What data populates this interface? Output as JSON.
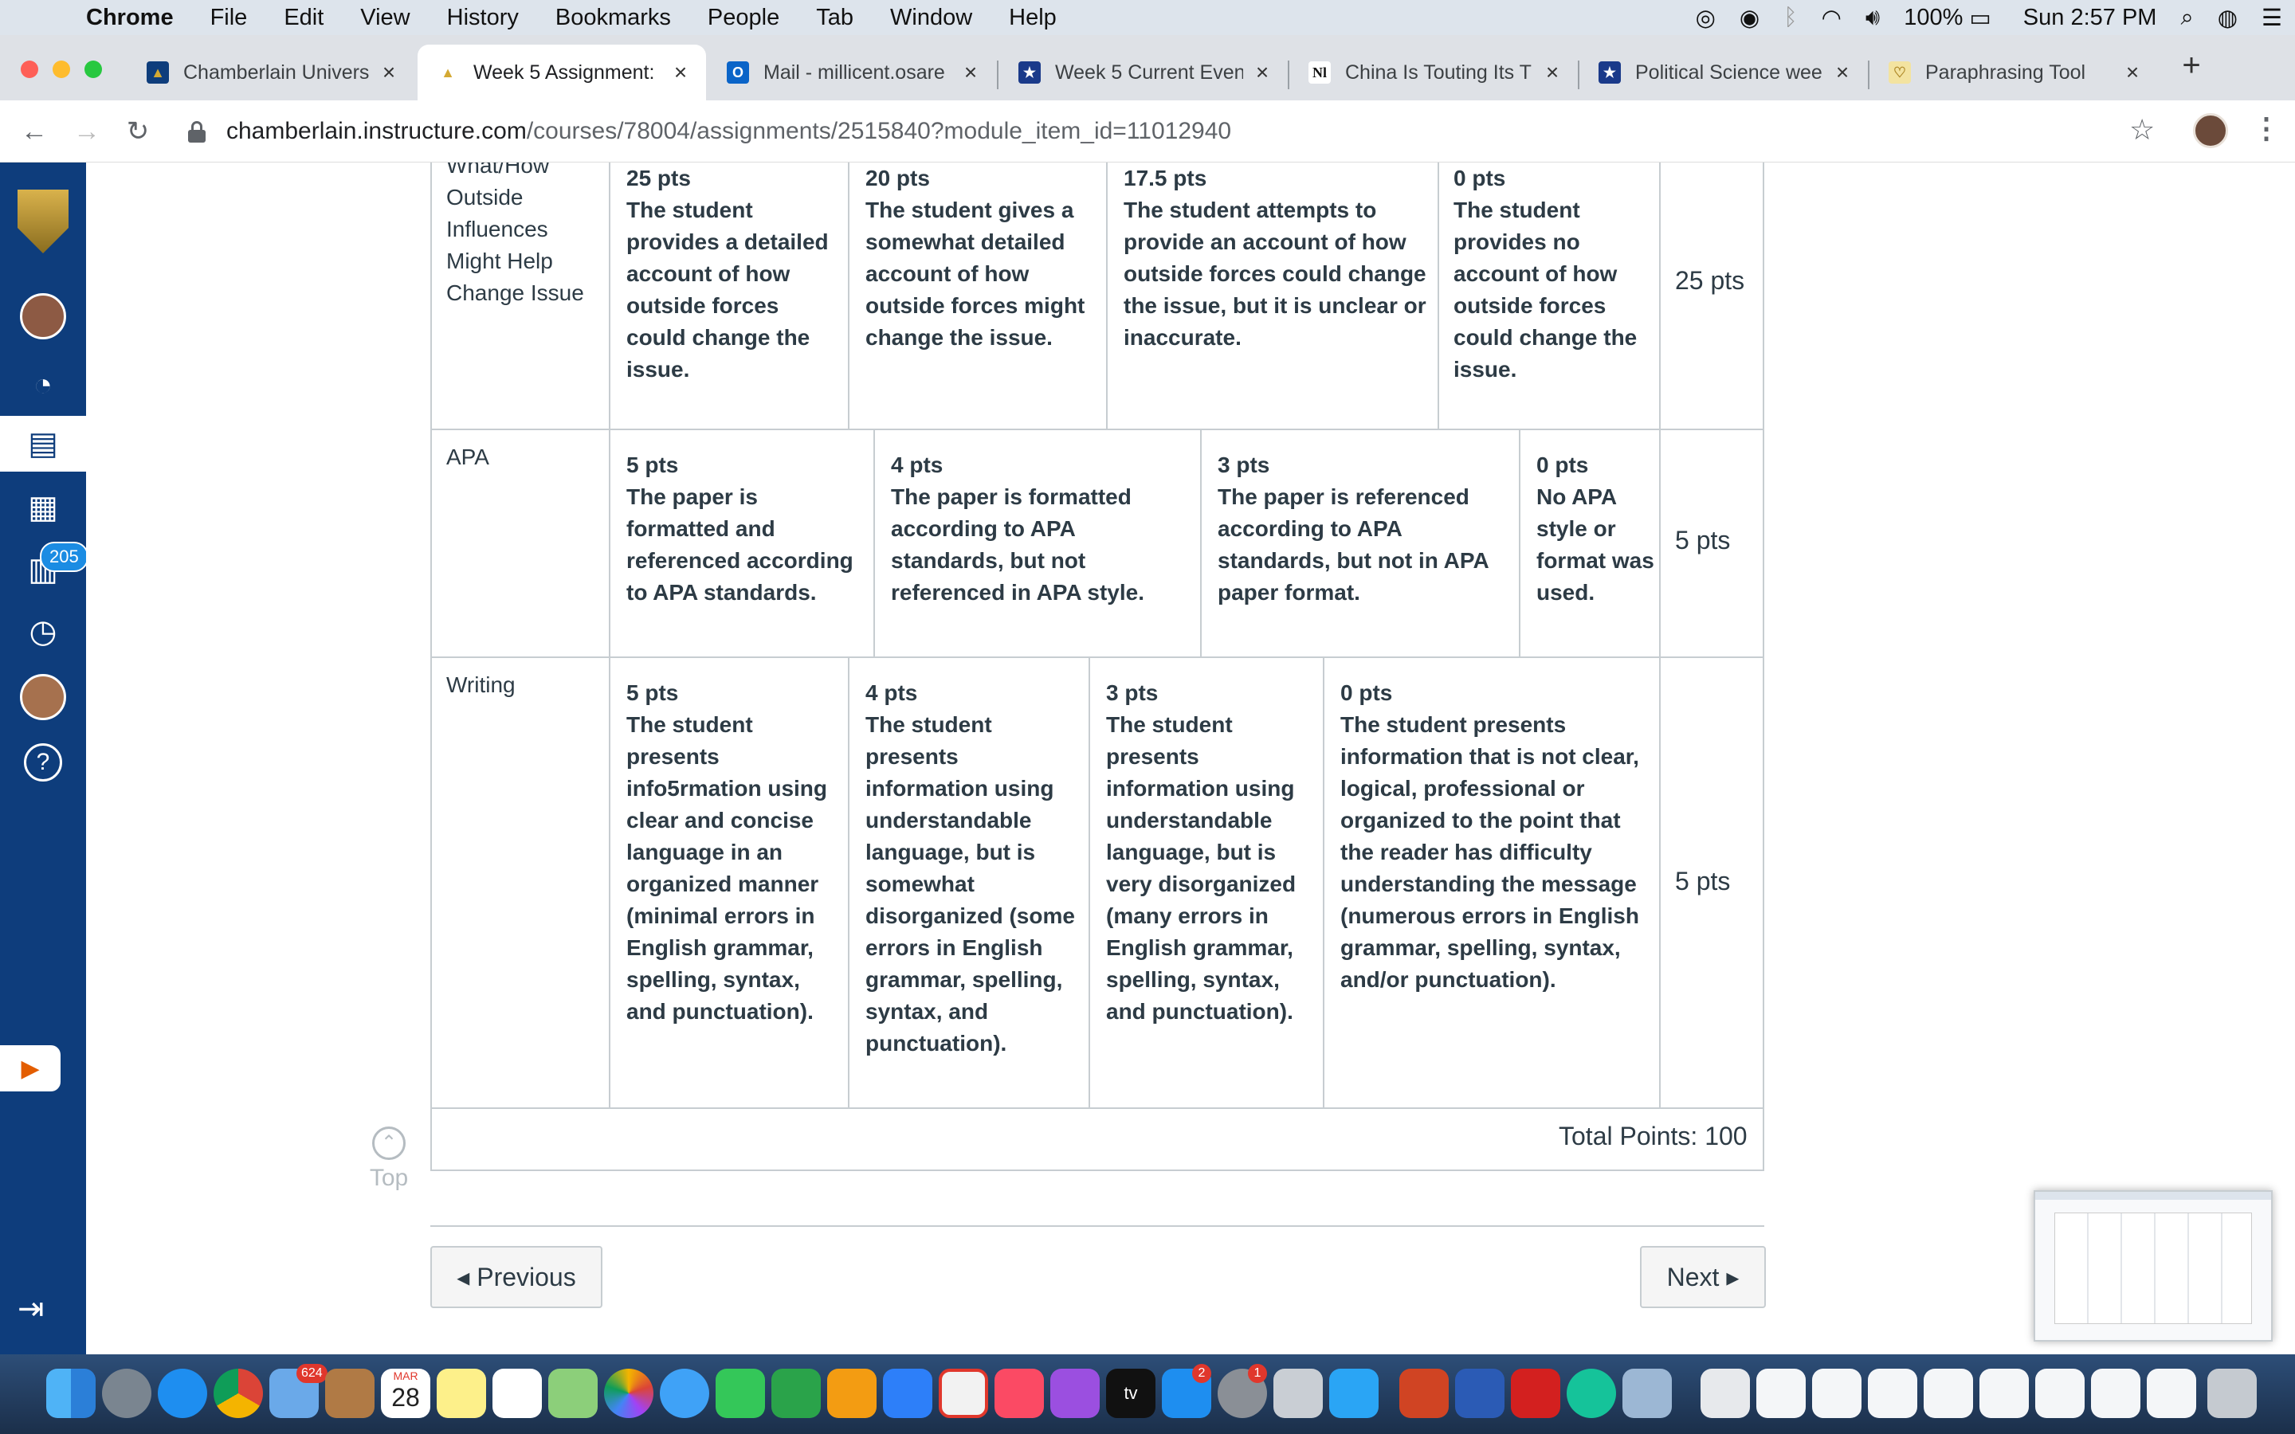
{
  "menubar": {
    "app": "Chrome",
    "items": [
      "File",
      "Edit",
      "View",
      "History",
      "Bookmarks",
      "People",
      "Tab",
      "Window",
      "Help"
    ],
    "battery": "100%",
    "clock": "Sun 2:57 PM"
  },
  "tabs": [
    {
      "title": "Chamberlain Univers",
      "fav_color": "#0e3d7c",
      "fav_glyph": "▲"
    },
    {
      "title": "Week 5 Assignment:",
      "fav_color": "#d4a933",
      "fav_glyph": "▲"
    },
    {
      "title": "Mail - millicent.osare",
      "fav_color": "#0a64c8",
      "fav_glyph": "O"
    },
    {
      "title": "Week 5 Current Even",
      "fav_color": "#1a3a8a",
      "fav_glyph": "★"
    },
    {
      "title": "China Is Touting Its T",
      "fav_color": "#ffffff",
      "fav_glyph": "Nl"
    },
    {
      "title": "Political Science wee",
      "fav_color": "#1a3a8a",
      "fav_glyph": "★"
    },
    {
      "title": "Paraphrasing Tool",
      "fav_color": "#f3e3a0",
      "fav_glyph": "♡"
    }
  ],
  "address": {
    "domain": "chamberlain.instructure.com",
    "path": "/courses/78004/assignments/2515840?module_item_id=11012940"
  },
  "nav": {
    "badge": "205"
  },
  "rubric": {
    "rows": [
      {
        "criterion": "What/How Outside Influences Might Help Change Issue",
        "ratings": [
          {
            "points": "25 pts",
            "desc": "The student provides a detailed account of how outside forces could change the issue."
          },
          {
            "points": "20 pts",
            "desc": "The student gives a somewhat detailed account of how outside forces might change the issue."
          },
          {
            "points": "17.5 pts",
            "desc": "The student attempts to provide an account of how outside forces could change the issue, but it is unclear or inaccurate."
          },
          {
            "points": "0 pts",
            "desc": "The student provides no account of how outside forces could change the issue."
          }
        ],
        "total": "25 pts"
      },
      {
        "criterion": "APA",
        "ratings": [
          {
            "points": "5 pts",
            "desc": "The paper is formatted and referenced according to APA standards."
          },
          {
            "points": "4 pts",
            "desc": "The paper is formatted according to APA standards, but not referenced in APA style."
          },
          {
            "points": "3 pts",
            "desc": "The paper is referenced according to APA standards, but not in APA paper format."
          },
          {
            "points": "0 pts",
            "desc": "No APA style or format was used."
          }
        ],
        "total": "5 pts"
      },
      {
        "criterion": "Writing",
        "ratings": [
          {
            "points": "5 pts",
            "desc": "The student presents info5rmation using clear and concise language in an organized manner (minimal errors in English grammar, spelling, syntax, and punctuation)."
          },
          {
            "points": "4 pts",
            "desc": "The student presents information using understandable language, but is somewhat disorganized (some errors in English grammar, spelling, syntax, and punctuation)."
          },
          {
            "points": "3 pts",
            "desc": "The student presents information using understandable language, but is very disorganized (many errors in English grammar, spelling, syntax, and punctuation)."
          },
          {
            "points": "0 pts",
            "desc": "The student presents information that is not clear, logical, professional or organized to the point that the reader has difficulty understanding the message (numerous errors in English grammar, spelling, syntax, and/or punctuation)."
          }
        ],
        "total": "5 pts"
      }
    ],
    "total_points": "Total Points: 100"
  },
  "top_label": "Top",
  "pager": {
    "prev": "◂ Previous",
    "next": "Next ▸"
  },
  "dock": {
    "mail_badge": "624",
    "calendar_month": "MAR",
    "calendar_day": "28",
    "appstore_badge": "2",
    "prefs_badge": "1",
    "tv_label": "tv"
  }
}
